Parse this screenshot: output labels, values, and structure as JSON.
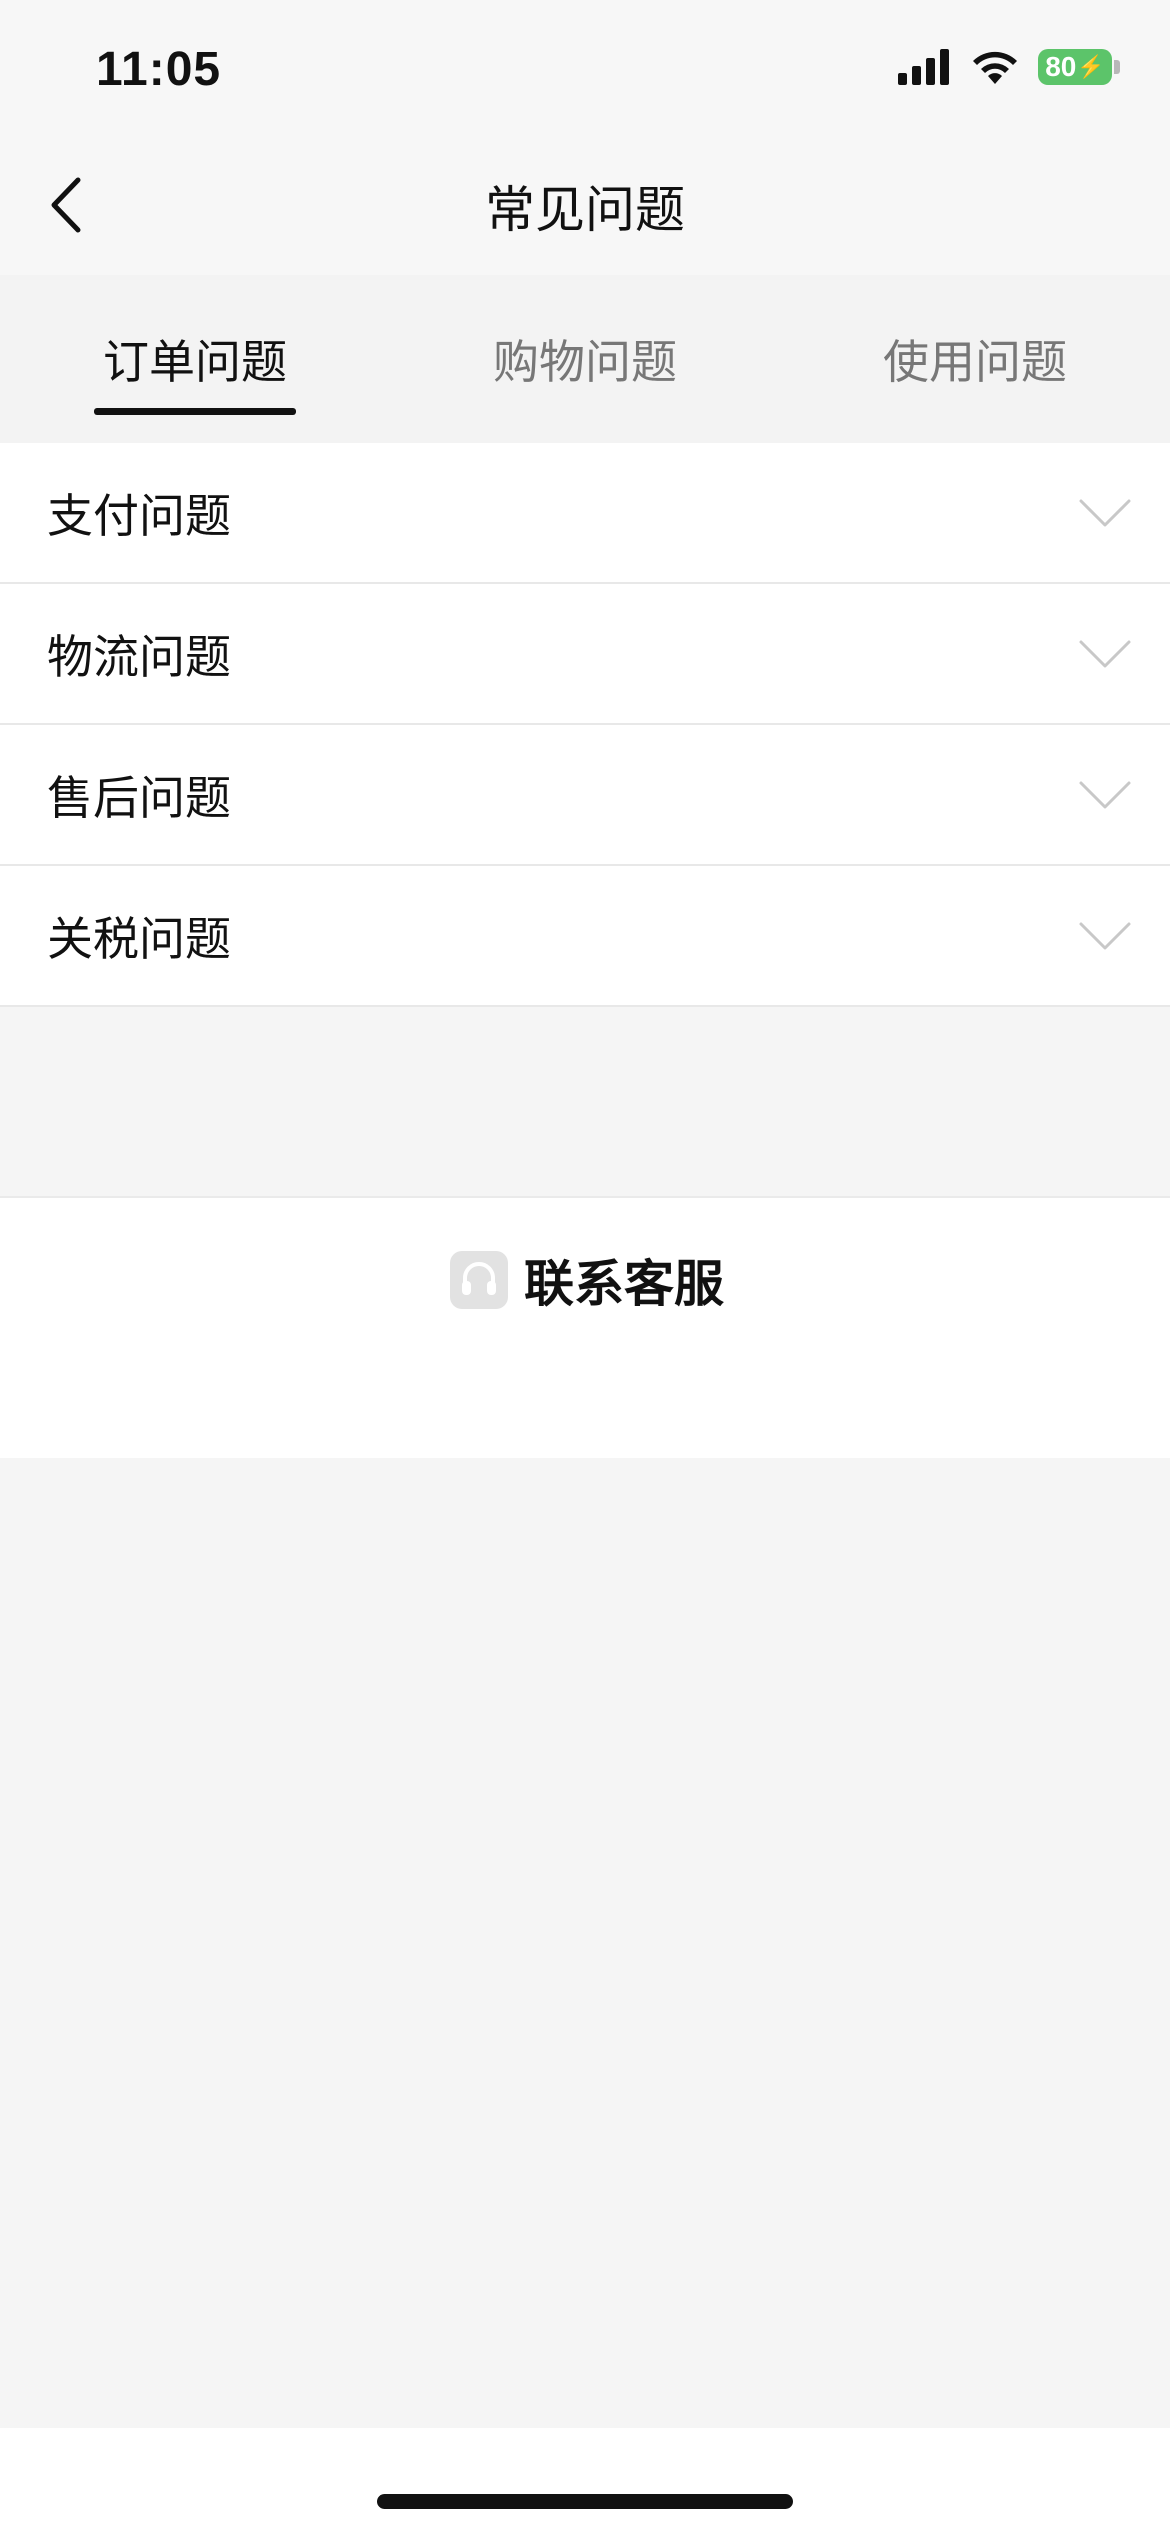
{
  "status_bar": {
    "time": "11:05",
    "battery_level": "80",
    "icons": [
      "signal-icon",
      "wifi-icon",
      "battery-charging-icon"
    ]
  },
  "nav": {
    "title": "常见问题",
    "back_icon": "chevron-left-icon"
  },
  "tabs": [
    {
      "label": "订单问题",
      "active": true
    },
    {
      "label": "购物问题",
      "active": false
    },
    {
      "label": "使用问题",
      "active": false
    }
  ],
  "faq_items": [
    {
      "label": "支付问题"
    },
    {
      "label": "物流问题"
    },
    {
      "label": "售后问题"
    },
    {
      "label": "关税问题"
    }
  ],
  "contact": {
    "label": "联系客服",
    "icon": "headset-icon"
  },
  "colors": {
    "battery": "#5cc46a",
    "active_tab_underline": "#111111",
    "page_background": "#f5f5f5"
  }
}
